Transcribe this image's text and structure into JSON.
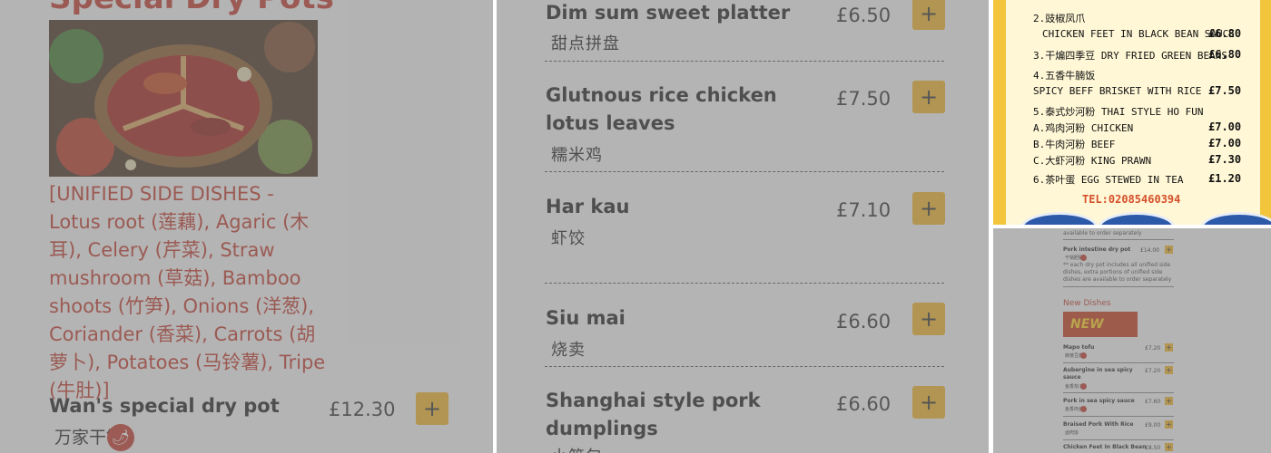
{
  "panel1": {
    "section_title": "Special Dry Pots",
    "side_dishes": "[UNIFIED SIDE DISHES - Lotus root (莲藕), Agaric (木耳), Celery (芹菜), Straw mushroom (草菇), Bamboo shoots (竹笋), Onions (洋葱), Coriander (香菜), Carrots (胡萝卜), Potatoes (马铃薯), Tripe (牛肚)]",
    "dish": {
      "name": "Wan's special dry pot",
      "price": "£12.30",
      "chinese": "万家干锅",
      "add": "+"
    }
  },
  "panel2": {
    "items": [
      {
        "name": "Dim sum sweet platter",
        "price": "£6.50",
        "chinese": "甜点拼盘",
        "add": "+"
      },
      {
        "name": "Glutnous rice chicken lotus leaves",
        "price": "£7.50",
        "chinese": "糯米鸡",
        "add": "+"
      },
      {
        "name": "Har kau",
        "price": "£7.10",
        "chinese": "虾饺",
        "add": "+"
      },
      {
        "name": "Siu mai",
        "price": "£6.60",
        "chinese": "烧卖",
        "add": "+"
      },
      {
        "name": "Shanghai style pork dumplings",
        "price": "£6.60",
        "chinese": "小笼包",
        "add": "+"
      }
    ]
  },
  "panel3": {
    "lines": [
      {
        "text": "2.豉椒凤爪",
        "price": ""
      },
      {
        "text": "CHICKEN FEET IN BLACK BEAN SAUCE",
        "price": "£6.80"
      },
      {
        "text": "3.干煸四季豆 DRY FRIED GREEN BEANS",
        "price": "£6.80"
      },
      {
        "text": "4.五香牛腩饭",
        "price": ""
      },
      {
        "text": "SPICY BEFF BRISKET WITH RICE",
        "price": "£7.50"
      },
      {
        "text": "5.泰式炒河粉 THAI STYLE HO FUN",
        "price": ""
      },
      {
        "text": "A.鸡肉河粉 CHICKEN",
        "price": "£7.00"
      },
      {
        "text": "B.牛肉河粉 BEEF",
        "price": "£7.00"
      },
      {
        "text": "C.大虾河粉 KING PRAWN",
        "price": "£7.30"
      },
      {
        "text": "6.茶叶蛋 EGG STEWED IN TEA",
        "price": "£1.20"
      }
    ],
    "tel": "TEL:02085460394"
  },
  "panel4": {
    "top_note": "available to order separately",
    "pork_item": {
      "name": "Pork intestine dry pot",
      "price": "£14.00",
      "chinese": "干锅肥肠"
    },
    "note": "** each dry pot includes all unified side dishes, extra portions of unified side dishes are available to order separately",
    "section_title": "New Dishes",
    "banner": "NEW",
    "items": [
      {
        "name": "Mapo tofu",
        "price": "£7.20",
        "chinese": "麻婆豆腐"
      },
      {
        "name": "Aubergine in sea spicy sauce",
        "price": "£7.20",
        "chinese": "鱼香茄子"
      },
      {
        "name": "Pork in sea spicy sauce",
        "price": "£7.60",
        "chinese": "鱼香肉丝"
      },
      {
        "name": "Braised Pork With Rice",
        "price": "£9.00",
        "chinese": "卤肉饭"
      },
      {
        "name": "Chicken Feet In Black Bean",
        "price": "£8.50",
        "chinese": ""
      }
    ],
    "add": "+"
  },
  "colors": {
    "accent_red": "#c0392b",
    "add_button": "#f0b429",
    "card_yellow": "#f2c53d"
  }
}
